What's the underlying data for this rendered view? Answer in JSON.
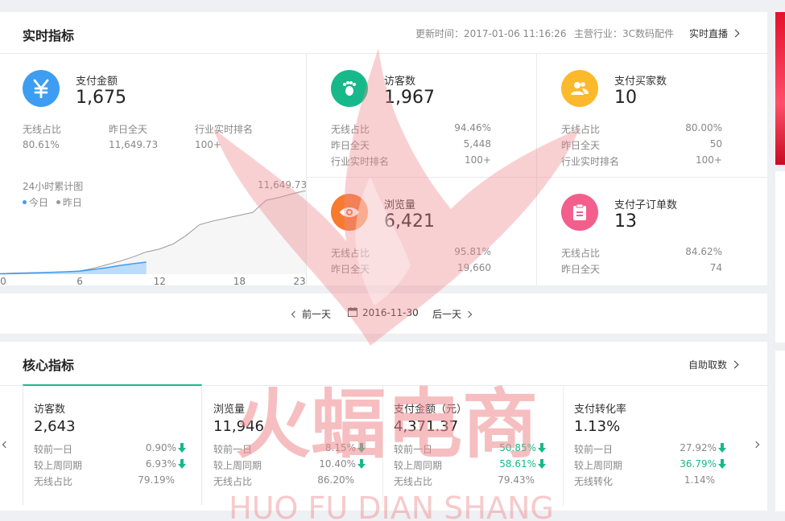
{
  "realtime": {
    "title": "实时指标",
    "update_time": "更新时间：2017-01-06 11:16:26",
    "industry": "主营行业：3C数码配件",
    "live_link": "实时直播",
    "pay_amount": {
      "label": "支付金额",
      "value": "1,675",
      "icon": "yen-icon",
      "sub_labels": [
        "无线占比",
        "昨日全天",
        "行业实时排名"
      ],
      "sub_values": [
        "80.61%",
        "11,649.73",
        "100+"
      ]
    },
    "visitors": {
      "label": "访客数",
      "value": "1,967",
      "icon": "footprint-icon",
      "rows": [
        [
          "无线占比",
          "94.46%"
        ],
        [
          "昨日全天",
          "5,448"
        ],
        [
          "行业实时排名",
          "100+"
        ]
      ]
    },
    "buyers": {
      "label": "支付买家数",
      "value": "10",
      "icon": "users-icon",
      "rows": [
        [
          "无线占比",
          "80.00%"
        ],
        [
          "昨日全天",
          "50"
        ],
        [
          "行业实时排名",
          "100+"
        ]
      ]
    },
    "pageviews": {
      "label": "浏览量",
      "value": "6,421",
      "icon": "eye-icon",
      "rows": [
        [
          "无线占比",
          "95.81%"
        ],
        [
          "昨日全天",
          "19,660"
        ]
      ]
    },
    "sub_orders": {
      "label": "支付子订单数",
      "value": "13",
      "icon": "clipboard-icon",
      "rows": [
        [
          "无线占比",
          "84.62%"
        ],
        [
          "昨日全天",
          "74"
        ]
      ]
    },
    "colors": {
      "blue": "#3d9df2",
      "green": "#17b98a",
      "yellow": "#fdb92c",
      "orange": "#f77a2f",
      "pink": "#f25f8d"
    }
  },
  "chart_data": {
    "type": "area",
    "title": "24小时累计图",
    "legend": [
      "今日",
      "昨日"
    ],
    "x_ticks": [
      "0",
      "6",
      "12",
      "18",
      "23"
    ],
    "max_label": "11,649.73",
    "series": [
      {
        "name": "今日",
        "x": [
          0,
          1,
          2,
          3,
          4,
          5,
          6,
          7,
          8,
          9,
          10,
          11
        ],
        "values": [
          40,
          90,
          140,
          190,
          260,
          330,
          420,
          640,
          900,
          1200,
          1450,
          1675
        ]
      },
      {
        "name": "昨日",
        "x": [
          0,
          1,
          2,
          3,
          4,
          5,
          6,
          7,
          8,
          9,
          10,
          11,
          12,
          13,
          14,
          15,
          16,
          17,
          18,
          19,
          20,
          21,
          22,
          23
        ],
        "values": [
          80,
          150,
          200,
          240,
          270,
          320,
          450,
          820,
          1300,
          1800,
          2400,
          3100,
          3500,
          4200,
          5400,
          6900,
          7400,
          7800,
          8200,
          8600,
          10300,
          10700,
          11200,
          11649.73
        ]
      }
    ],
    "ylim": [
      0,
      11649.73
    ],
    "xlim": [
      0,
      23
    ]
  },
  "date_nav": {
    "prev": "前一天",
    "date": "2016-11-30",
    "next": "后一天"
  },
  "core": {
    "title": "核心指标",
    "link": "自助取数",
    "cards": [
      {
        "title": "访客数",
        "value": "2,643",
        "rows": [
          {
            "label": "较前一日",
            "value": "0.90%",
            "color": "#888",
            "arrow": true
          },
          {
            "label": "较上周同期",
            "value": "6.93%",
            "color": "#888",
            "arrow": true
          },
          {
            "label": "无线占比",
            "value": "79.19%",
            "color": "#888",
            "arrow": false
          }
        ]
      },
      {
        "title": "浏览量",
        "value": "11,946",
        "rows": [
          {
            "label": "较前一日",
            "value": "8.15%",
            "color": "#888",
            "arrow": true
          },
          {
            "label": "较上周同期",
            "value": "10.40%",
            "color": "#888",
            "arrow": true
          },
          {
            "label": "无线占比",
            "value": "86.20%",
            "color": "#888",
            "arrow": false
          }
        ]
      },
      {
        "title": "支付金额（元）",
        "value": "4,371.37",
        "rows": [
          {
            "label": "较前一日",
            "value": "50.85%",
            "color": "#17b98a",
            "arrow": true
          },
          {
            "label": "较上周同期",
            "value": "58.61%",
            "color": "#17b98a",
            "arrow": true
          },
          {
            "label": "无线占比",
            "value": "79.43%",
            "color": "#888",
            "arrow": false
          }
        ]
      },
      {
        "title": "支付转化率",
        "value": "1.13%",
        "rows": [
          {
            "label": "较前一日",
            "value": "27.92%",
            "color": "#888",
            "arrow": true
          },
          {
            "label": "较上周同期",
            "value": "36.79%",
            "color": "#17b98a",
            "arrow": true
          },
          {
            "label": "无线转化",
            "value": "1.14%",
            "color": "#888",
            "arrow": false
          }
        ]
      }
    ]
  },
  "watermark": {
    "cn": "火蝠电商",
    "en": "HUO FU DIAN SHANG",
    "color": "#f0a0a3"
  }
}
